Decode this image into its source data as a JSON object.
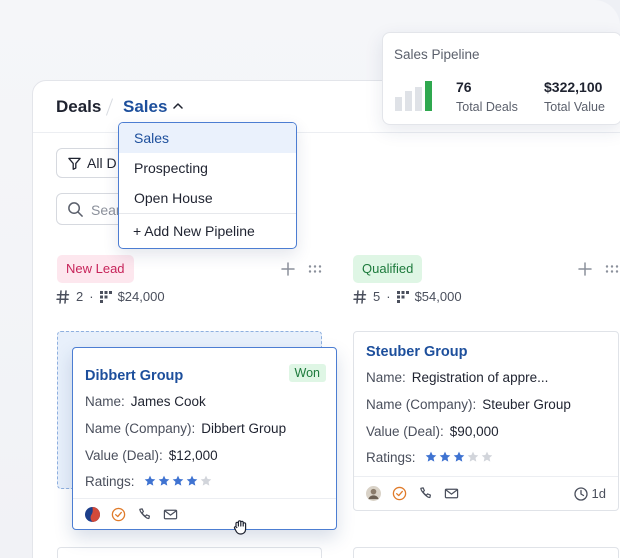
{
  "header": {
    "title": "Deals",
    "pipeline": "Sales"
  },
  "toolbar": {
    "filter_label": "All D",
    "search_placeholder": "Sear"
  },
  "pipeline_dropdown": {
    "items": [
      {
        "label": "Sales",
        "selected": true
      },
      {
        "label": "Prospecting"
      },
      {
        "label": "Open House"
      }
    ],
    "add_label": "+ Add New Pipeline"
  },
  "summary": {
    "title": "Sales Pipeline",
    "total_deals": "76",
    "total_deals_label": "Total Deals",
    "total_value": "$322,100",
    "total_value_label": "Total Value"
  },
  "columns": [
    {
      "name": "New Lead",
      "count": "2",
      "amount": "$24,000",
      "color": "#c7245a"
    },
    {
      "name": "Qualified",
      "count": "5",
      "amount": "$54,000",
      "color": "#1d7a3c"
    }
  ],
  "cards": {
    "dibbert": {
      "title": "Dibbert Group",
      "badge": "Won",
      "name_label": "Name:",
      "name": "James Cook",
      "company_label": "Name (Company):",
      "company": "Dibbert Group",
      "value_label": "Value (Deal):",
      "value": "$12,000",
      "ratings_label": "Ratings:",
      "rating": 4
    },
    "steuber": {
      "title": "Steuber Group",
      "name_label": "Name:",
      "name": "Registration of appre...",
      "company_label": "Name (Company):",
      "company": "Steuber Group",
      "value_label": "Value (Deal):",
      "value": "$90,000",
      "ratings_label": "Ratings:",
      "rating": 3,
      "days": "1d"
    }
  },
  "colors": {
    "accent": "#1d4f9c",
    "star_on": "#3f73d1",
    "star_off": "#d2d5db"
  }
}
